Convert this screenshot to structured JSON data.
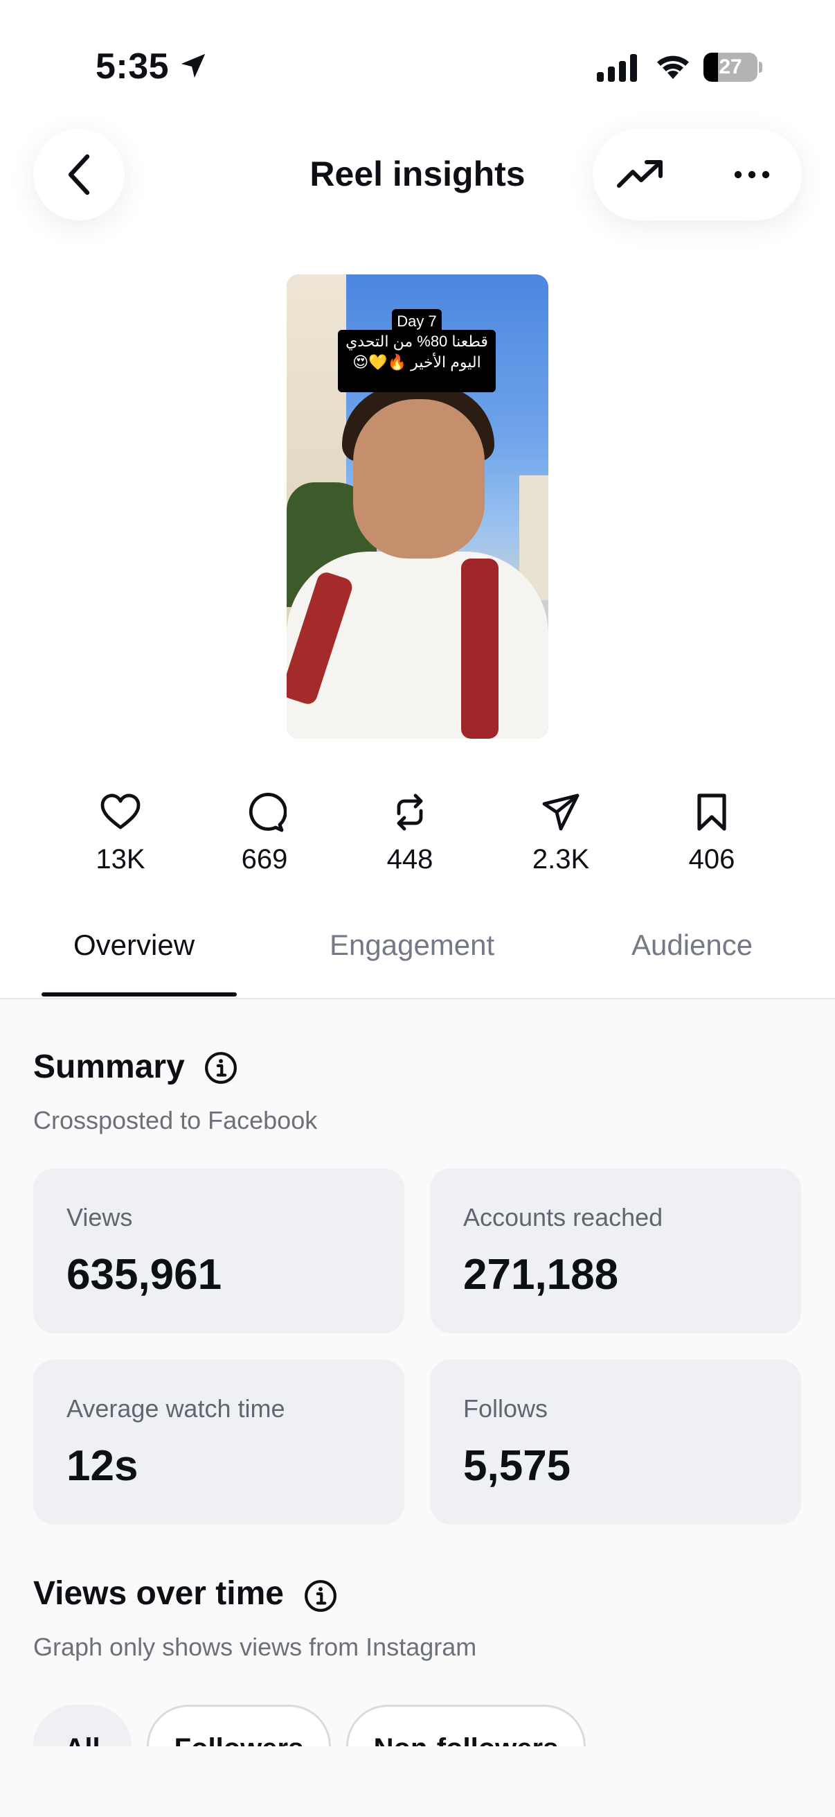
{
  "status_bar": {
    "time": "5:35",
    "battery_level": "27",
    "battery_fraction": 0.27
  },
  "header": {
    "title": "Reel insights"
  },
  "reel": {
    "caption_day": "Day 7",
    "caption_line1": "قطعنا 80% من التحدي",
    "caption_line2": "اليوم الأخير 🔥💛😍"
  },
  "stats": [
    {
      "icon": "heart-icon",
      "value": "13K"
    },
    {
      "icon": "comment-icon",
      "value": "669"
    },
    {
      "icon": "repost-icon",
      "value": "448"
    },
    {
      "icon": "share-icon",
      "value": "2.3K"
    },
    {
      "icon": "bookmark-icon",
      "value": "406"
    }
  ],
  "tabs": [
    {
      "label": "Overview",
      "active": true
    },
    {
      "label": "Engagement",
      "active": false
    },
    {
      "label": "Audience",
      "active": false
    }
  ],
  "summary": {
    "title": "Summary",
    "subtitle": "Crossposted to Facebook",
    "cards": [
      {
        "label": "Views",
        "value": "635,961"
      },
      {
        "label": "Accounts reached",
        "value": "271,188"
      },
      {
        "label": "Average watch time",
        "value": "12s"
      },
      {
        "label": "Follows",
        "value": "5,575"
      }
    ]
  },
  "views_over_time": {
    "title": "Views over time",
    "subtitle": "Graph only shows views from Instagram",
    "filters": [
      {
        "label": "All",
        "selected": true
      },
      {
        "label": "Followers",
        "selected": false
      },
      {
        "label": "Non-followers",
        "selected": false
      }
    ]
  },
  "colors": {
    "text_primary": "#0c0f14",
    "text_secondary": "#6b7079",
    "card_background": "#eff0f3"
  }
}
